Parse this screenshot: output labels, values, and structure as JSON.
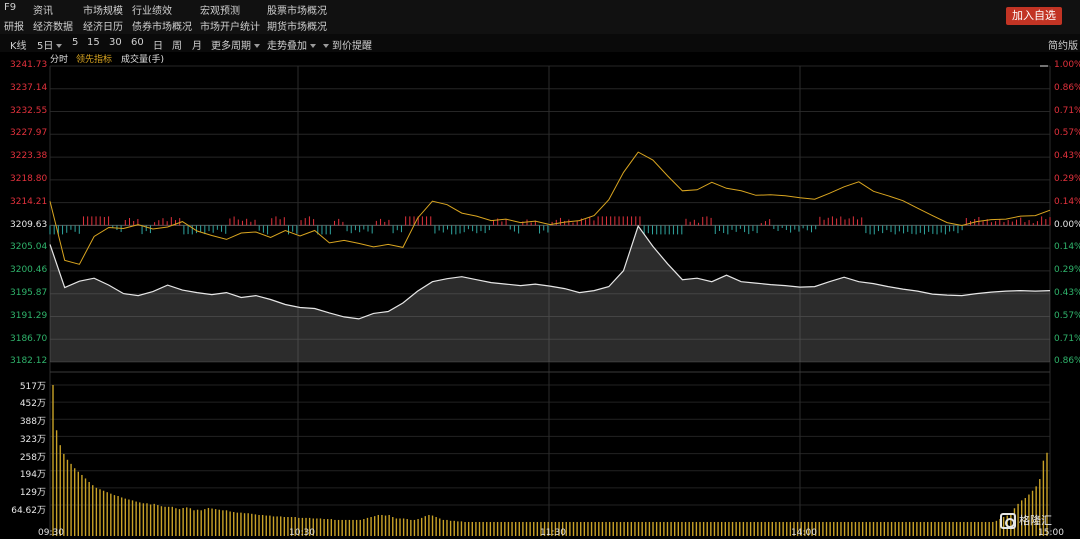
{
  "menu": {
    "row1": [
      "F9",
      "资讯",
      "市场规模",
      "行业绩效",
      "宏观预测",
      "股票市场概况"
    ],
    "row2": [
      "研报",
      "经济数据",
      "经济日历",
      "债券市场概况",
      "市场开户统计",
      "期货市场概况"
    ],
    "add_button": "加入自选"
  },
  "toolbar": {
    "items": [
      "K线",
      "5日",
      "5",
      "15",
      "30",
      "60",
      "日",
      "周",
      "月",
      "更多周期",
      "走势叠加",
      "到价提醒"
    ],
    "simple_label": "简约版"
  },
  "subtabs": {
    "time_share": "分时",
    "leading_indicator": "领先指标",
    "volume": "成交量(手)"
  },
  "price_axis": {
    "left_labels": [
      "3241.73",
      "3237.14",
      "3232.55",
      "3227.97",
      "3223.38",
      "3218.80",
      "3214.21",
      "3209.63",
      "3205.04",
      "3200.46",
      "3195.87",
      "3191.29",
      "3186.70",
      "3182.12"
    ],
    "right_labels": [
      "1.00%",
      "0.86%",
      "0.71%",
      "0.57%",
      "0.43%",
      "0.29%",
      "0.14%",
      "0.00%",
      "0.14%",
      "0.29%",
      "0.43%",
      "0.57%",
      "0.71%",
      "0.86%"
    ]
  },
  "volume_axis": {
    "labels": [
      "517万",
      "452万",
      "388万",
      "323万",
      "258万",
      "194万",
      "129万",
      "64.62万"
    ]
  },
  "time_axis": {
    "labels": [
      "09:30",
      "10:30",
      "11:30",
      "14:00",
      "15:00"
    ]
  },
  "colors": {
    "up": "#e2313c",
    "down": "#2fb36b",
    "neutral": "#e8e8e8",
    "leading_line": "#d9a520",
    "price_line": "#e6e6e6",
    "volume_bar": "#c9a227"
  },
  "chart_data": {
    "type": "line",
    "ylim": [
      3182.12,
      3241.73
    ],
    "prev_close": 3209.63,
    "time_labels": [
      "09:30",
      "10:30",
      "11:30",
      "14:00",
      "15:00"
    ],
    "series": [
      {
        "name": "领先指标",
        "values": [
          3214.5,
          3202.6,
          3201.8,
          3207.4,
          3209.2,
          3209.0,
          3209.8,
          3208.9,
          3209.3,
          3210.4,
          3208.5,
          3207.6,
          3206.8,
          3208.1,
          3208.3,
          3207.2,
          3208.6,
          3207.5,
          3208.6,
          3206.1,
          3206.6,
          3206.0,
          3205.3,
          3205.8,
          3205.2,
          3211.1,
          3214.5,
          3213.8,
          3212.1,
          3211.5,
          3210.6,
          3210.9,
          3210.2,
          3210.5,
          3209.8,
          3210.3,
          3210.6,
          3211.6,
          3214.8,
          3220.3,
          3224.4,
          3222.8,
          3219.6,
          3216.6,
          3216.8,
          3218.3,
          3217.1,
          3216.6,
          3215.7,
          3215.8,
          3215.6,
          3215.2,
          3214.9,
          3216.1,
          3217.4,
          3218.4,
          3216.5,
          3215.6,
          3214.6,
          3213.1,
          3211.6,
          3210.2,
          3209.6,
          3210.4,
          3210.8,
          3210.9,
          3211.5,
          3211.6,
          3212.7
        ]
      },
      {
        "name": "分时",
        "values": [
          3205.8,
          3197.1,
          3198.4,
          3199.0,
          3197.6,
          3195.9,
          3195.5,
          3196.3,
          3197.6,
          3196.6,
          3196.1,
          3195.7,
          3196.1,
          3195.1,
          3195.5,
          3194.7,
          3193.7,
          3193.1,
          3192.9,
          3192.0,
          3191.2,
          3190.8,
          3191.9,
          3192.3,
          3194.0,
          3196.4,
          3198.3,
          3198.9,
          3199.3,
          3198.7,
          3198.1,
          3197.8,
          3197.5,
          3197.8,
          3197.4,
          3196.9,
          3196.1,
          3196.5,
          3197.3,
          3200.5,
          3209.5,
          3205.4,
          3201.9,
          3198.7,
          3199.0,
          3198.3,
          3199.6,
          3198.3,
          3198.0,
          3197.7,
          3197.5,
          3197.2,
          3197.3,
          3198.3,
          3199.2,
          3198.3,
          3197.9,
          3197.3,
          3196.8,
          3196.4,
          3195.8,
          3195.6,
          3195.5,
          3195.9,
          3196.2,
          3196.4,
          3196.5,
          3196.4,
          3196.5
        ]
      }
    ],
    "volume_series": {
      "name": "成交量(手)",
      "ylim": [
        0,
        517
      ],
      "values": [
        517,
        362,
        311,
        281,
        261,
        247,
        232,
        220,
        209,
        197,
        185,
        174,
        165,
        160,
        155,
        150,
        145,
        140,
        137,
        132,
        128,
        125,
        122,
        118,
        115,
        112,
        112,
        108,
        110,
        106,
        102,
        100,
        100,
        100,
        95,
        92,
        96,
        98,
        95,
        88,
        90,
        88,
        92,
        96,
        94,
        92,
        90,
        88,
        88,
        84,
        82,
        80,
        80,
        78,
        78,
        76,
        74,
        72,
        72,
        70,
        70,
        67,
        67,
        67,
        65,
        65,
        65,
        65,
        62,
        62,
        62,
        62,
        60,
        60,
        60,
        58,
        58,
        58,
        55,
        55,
        55,
        55,
        55,
        55,
        55,
        55,
        58,
        62,
        65,
        68,
        72,
        72,
        70,
        72,
        65,
        60,
        60,
        60,
        58,
        55,
        55,
        58,
        62,
        68,
        72,
        70,
        65,
        60,
        55,
        55,
        52,
        52,
        50,
        50,
        48,
        48,
        48,
        48,
        48,
        48,
        48,
        48,
        48,
        48,
        48,
        48,
        48,
        48,
        48,
        48,
        48,
        48,
        48,
        48,
        48,
        48,
        48,
        48,
        48,
        48,
        48,
        48,
        48,
        48,
        48,
        48,
        48,
        48,
        48,
        48,
        48,
        48,
        48,
        48,
        48,
        48,
        48,
        48,
        48,
        48,
        48,
        48,
        48,
        48,
        48,
        48,
        48,
        48,
        48,
        48,
        48,
        48,
        48,
        48,
        48,
        48,
        48,
        48,
        48,
        48,
        48,
        48,
        48,
        48,
        48,
        48,
        48,
        48,
        48,
        48,
        48,
        48,
        48,
        48,
        48,
        48,
        48,
        48,
        48,
        48,
        48,
        48,
        48,
        48,
        48,
        48,
        48,
        48,
        48,
        48,
        48,
        48,
        48,
        48,
        48,
        48,
        48,
        48,
        48,
        48,
        48,
        48,
        48,
        48,
        48,
        48,
        48,
        48,
        48,
        48,
        48,
        48,
        48,
        48,
        48,
        48,
        48,
        48,
        48,
        48,
        48,
        48,
        48,
        48,
        48,
        48,
        48,
        48,
        48,
        48,
        48,
        48,
        48,
        48,
        48,
        48,
        48,
        48,
        48,
        48,
        48,
        52,
        58,
        65,
        70,
        78,
        95,
        110,
        122,
        130,
        142,
        155,
        170,
        195,
        258,
        285
      ]
    }
  }
}
